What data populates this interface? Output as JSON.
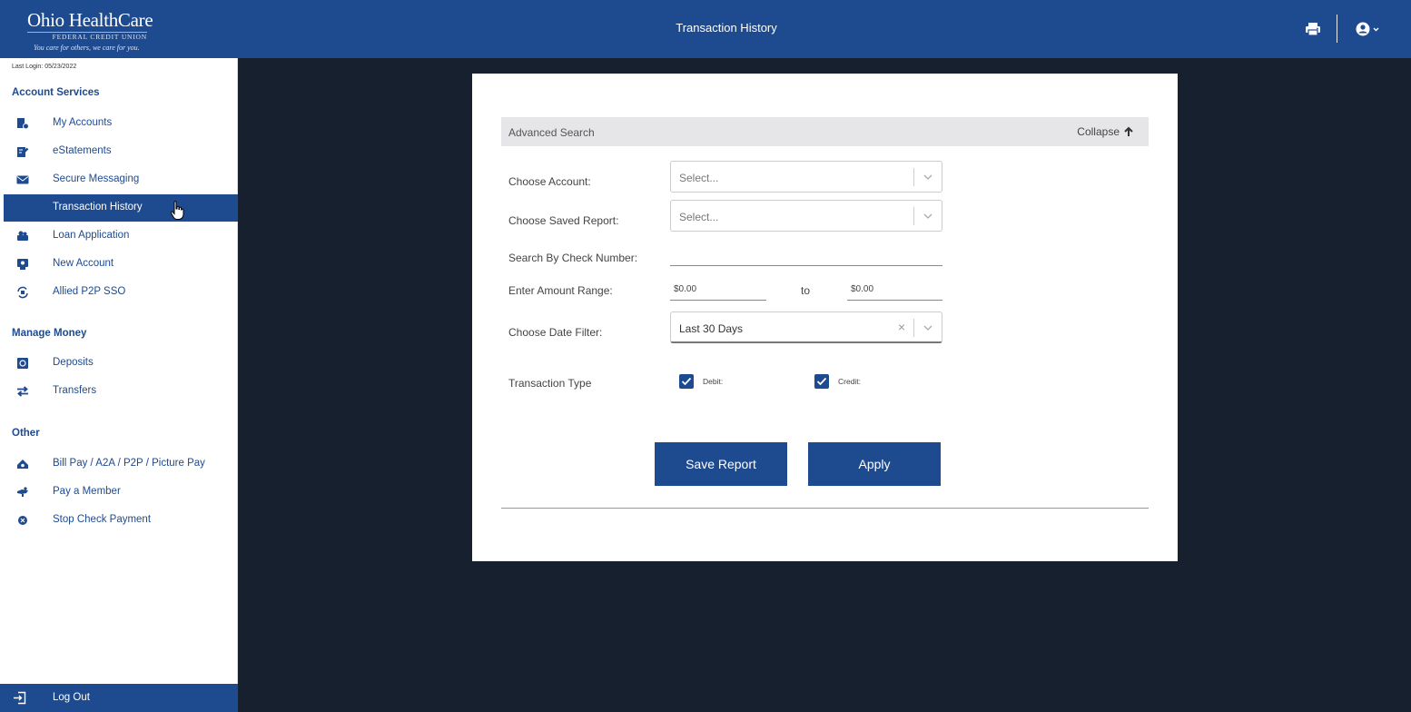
{
  "header": {
    "logo_main": "Ohio HealthCare",
    "logo_sub": "FEDERAL CREDIT UNION",
    "logo_tagline": "You care for others, we care for you.",
    "title": "Transaction History",
    "print_icon": "printer-icon",
    "user_icon": "user-circle-icon"
  },
  "sidebar": {
    "last_login": "Last Login: 05/23/2022",
    "sections": {
      "account_services": "Account Services",
      "manage_money": "Manage Money",
      "other": "Other"
    },
    "items": [
      {
        "label": "My Accounts",
        "icon": "accounts-icon"
      },
      {
        "label": "eStatements",
        "icon": "statement-icon"
      },
      {
        "label": "Secure Messaging",
        "icon": "envelope-icon"
      },
      {
        "label": "Transaction History",
        "icon": "history-icon",
        "active": true
      },
      {
        "label": "Loan Application",
        "icon": "loan-icon"
      },
      {
        "label": "New Account",
        "icon": "new-account-icon"
      },
      {
        "label": "Allied P2P SSO",
        "icon": "transfer-cycle-icon"
      },
      {
        "label": "Deposits",
        "icon": "vault-icon"
      },
      {
        "label": "Transfers",
        "icon": "exchange-icon"
      },
      {
        "label": "Bill Pay / A2A / P2P / Picture Pay",
        "icon": "bill-pay-icon"
      },
      {
        "label": "Pay a Member",
        "icon": "pay-member-icon"
      },
      {
        "label": "Stop Check Payment",
        "icon": "stop-icon"
      }
    ],
    "logout": "Log Out"
  },
  "search": {
    "title": "Advanced Search",
    "collapse": "Collapse",
    "choose_account_label": "Choose Account:",
    "choose_account_placeholder": "Select...",
    "saved_report_label": "Choose Saved Report:",
    "saved_report_placeholder": "Select...",
    "check_number_label": "Search By Check Number:",
    "check_number_value": "",
    "amount_range_label": "Enter Amount Range:",
    "amount_from": "$0.00",
    "amount_to_word": "to",
    "amount_to": "$0.00",
    "date_filter_label": "Choose Date Filter:",
    "date_filter_value": "Last 30 Days",
    "transaction_type_label": "Transaction Type",
    "debit_label": "Debit:",
    "debit_checked": true,
    "credit_label": "Credit:",
    "credit_checked": true,
    "save_report": "Save Report",
    "apply": "Apply"
  },
  "colors": {
    "brand": "#1e4a8f",
    "background": "#16202e"
  }
}
